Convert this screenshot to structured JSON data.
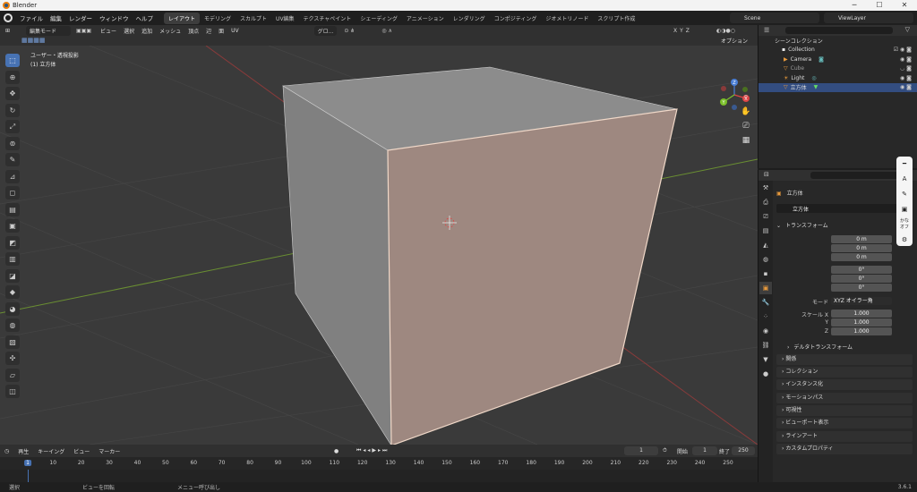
{
  "window": {
    "title": "Blender",
    "minimize": "─",
    "maximize": "☐",
    "close": "✕"
  },
  "menus": [
    "ファイル",
    "編集",
    "レンダー",
    "ウィンドウ",
    "ヘルプ"
  ],
  "workspaces": [
    "レイアウト",
    "モデリング",
    "スカルプト",
    "UV編集",
    "テクスチャペイント",
    "シェーディング",
    "アニメーション",
    "レンダリング",
    "コンポジティング",
    "ジオメトリノード",
    "スクリプト作成"
  ],
  "scene": "Scene",
  "view_layer": "ViewLayer",
  "viewport": {
    "mode": "編集モード",
    "menus": [
      "ビュー",
      "選択",
      "追加",
      "メッシュ",
      "頂点",
      "辺",
      "面",
      "UV"
    ],
    "transform_orientation": "グロ...",
    "axes": [
      "X",
      "Y",
      "Z"
    ],
    "options": "オプション",
    "view_name": "ユーザー・透視投影",
    "object_label": "(1) 立方体"
  },
  "gizmo": {
    "x": "X",
    "y": "Y",
    "z": "Z"
  },
  "timeline": {
    "menus": [
      "再生",
      "キーイング",
      "ビュー",
      "マーカー"
    ],
    "current_frame": "1",
    "start_label": "開始",
    "start": "1",
    "end_label": "終了",
    "end": "250",
    "ruler": [
      "1",
      "10",
      "20",
      "30",
      "40",
      "50",
      "60",
      "70",
      "80",
      "90",
      "100",
      "110",
      "120",
      "130",
      "140",
      "150",
      "160",
      "170",
      "180",
      "190",
      "200",
      "210",
      "220",
      "230",
      "240",
      "250"
    ]
  },
  "status": {
    "select": "選択",
    "rotate": "ビューを回転",
    "menu": "メニュー呼び出し",
    "version": "3.6.1"
  },
  "outliner": {
    "root": "シーンコレクション",
    "collection": "Collection",
    "items": [
      "Camera",
      "Cube",
      "Light",
      "立方体"
    ]
  },
  "properties": {
    "object_name": "立方体",
    "data_name": "立方体",
    "transform": "トランスフォーム",
    "location_label": "位置 X",
    "rotation_label": "回転 X",
    "scale_label": "スケール X",
    "y": "Y",
    "z": "Z",
    "loc": [
      "0 m",
      "0 m",
      "0 m"
    ],
    "rot": [
      "0°",
      "0°",
      "0°"
    ],
    "scale": [
      "1.000",
      "1.000",
      "1.000"
    ],
    "mode_label": "モード",
    "mode_value": "XYZ オイラー角",
    "delta": "デルタトランスフォーム",
    "panels": [
      "関係",
      "コレクション",
      "インスタンス化",
      "モーションパス",
      "可視性",
      "ビューポート表示",
      "ラインアート",
      "カスタムプロパティ"
    ]
  },
  "ime": {
    "char": "A",
    "kana_1": "かな",
    "kana_2": "オフ"
  }
}
